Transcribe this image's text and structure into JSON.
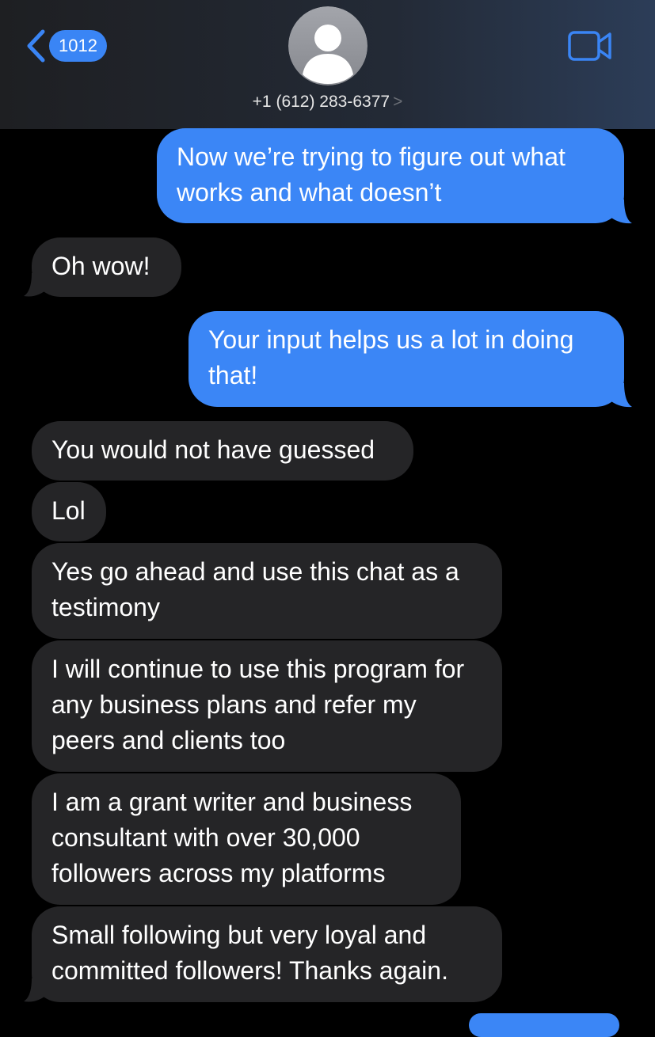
{
  "header": {
    "back_badge": "1012",
    "contact_name": "+1 (612) 283-6377",
    "contact_chevron": ">"
  },
  "icons": {
    "back": "chevron-left-icon",
    "avatar": "person-silhouette-icon",
    "video": "video-camera-icon"
  },
  "colors": {
    "outgoing_bubble": "#3b86f6",
    "incoming_bubble": "#252527",
    "accent": "#3a85f5"
  },
  "messages": [
    {
      "direction": "outgoing",
      "text": "Now we’re trying to figure out what works and what doesn’t"
    },
    {
      "direction": "incoming",
      "text": "Oh wow!"
    },
    {
      "direction": "outgoing",
      "text": "Your input helps us a lot in doing that!"
    },
    {
      "direction": "incoming",
      "text": "You would not have guessed"
    },
    {
      "direction": "incoming",
      "text": "Lol"
    },
    {
      "direction": "incoming",
      "text": "Yes go ahead and use this chat as a testimony"
    },
    {
      "direction": "incoming",
      "text": "I will continue to use this program for any business plans and refer my peers and clients too"
    },
    {
      "direction": "incoming",
      "text": "I am a grant writer and business consultant with over 30,000 followers across my platforms"
    },
    {
      "direction": "incoming",
      "text": "Small following but very loyal and committed followers! Thanks again."
    }
  ]
}
